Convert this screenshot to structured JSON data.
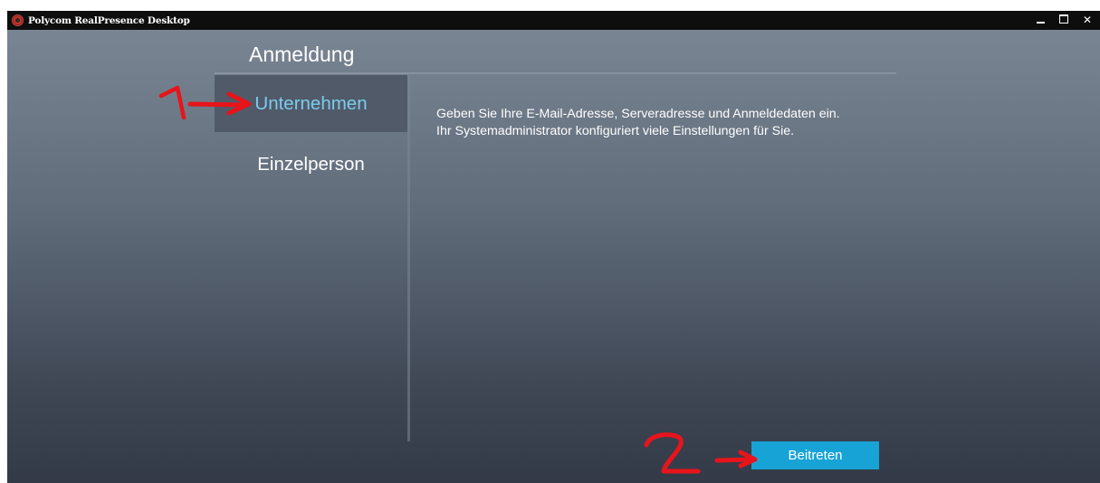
{
  "window": {
    "title": "Polycom RealPresence Desktop",
    "controls": {
      "minimize": "minimize",
      "maximize": "maximize",
      "close": "✕"
    }
  },
  "login": {
    "heading": "Anmeldung",
    "tabs": [
      {
        "label": "Unternehmen",
        "active": true
      },
      {
        "label": "Einzelperson",
        "active": false
      }
    ],
    "description": [
      "Geben Sie Ihre E-Mail-Adresse, Serveradresse und Anmeldedaten ein.",
      "Ihr Systemadministrator konfiguriert viele Einstellungen für Sie."
    ],
    "join_button": "Beitreten"
  },
  "colors": {
    "accent": "#18a3d6",
    "active_tab_text": "#7ecbf0",
    "annotation": "#e8141b"
  }
}
